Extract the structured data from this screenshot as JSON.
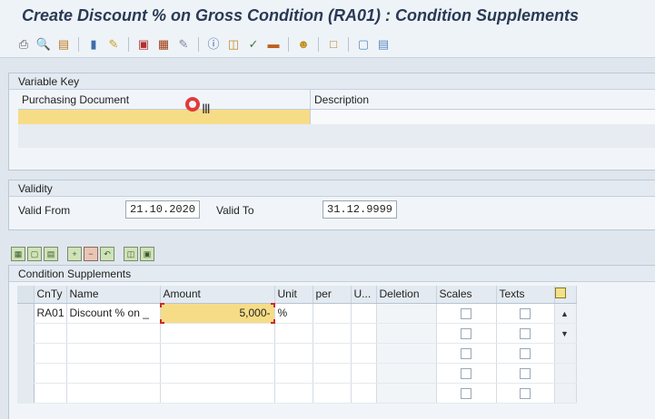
{
  "window": {
    "title": "Create Discount % on Gross Condition (RA01) : Condition Supplements"
  },
  "toolbar": {
    "icons": [
      "print-icon",
      "find-icon",
      "find-next-icon",
      "first-page-icon",
      "previous-icon",
      "next-icon",
      "last-page-icon",
      "edit-icon",
      "info-icon",
      "copy-icon",
      "expand-icon",
      "collapse-icon",
      "user-icon",
      "save-icon",
      "help-icon",
      "settings-icon"
    ]
  },
  "variable_key": {
    "section_label": "Variable Key",
    "col_purchasing_document": "Purchasing Document",
    "col_description": "Description",
    "purchasing_document_value": "",
    "description_value": ""
  },
  "validity": {
    "section_label": "Validity",
    "valid_from_label": "Valid From",
    "valid_from_value": "21.10.2020",
    "valid_to_label": "Valid To",
    "valid_to_value": "31.12.9999"
  },
  "condition_supplements": {
    "section_label": "Condition Supplements",
    "columns": [
      "CnTy",
      "Name",
      "Amount",
      "Unit",
      "per",
      "U...",
      "Deletion",
      "Scales",
      "Texts"
    ],
    "rows": [
      {
        "cnty": "RA01",
        "name": "Discount % on _",
        "amount": "5,000-",
        "unit": "%",
        "per": "",
        "u": "",
        "deletion": ""
      }
    ]
  },
  "colors": {
    "accent_yellow": "#f7dc87",
    "title_blue": "#2a3a55",
    "focus_red": "#cc2a2a"
  }
}
